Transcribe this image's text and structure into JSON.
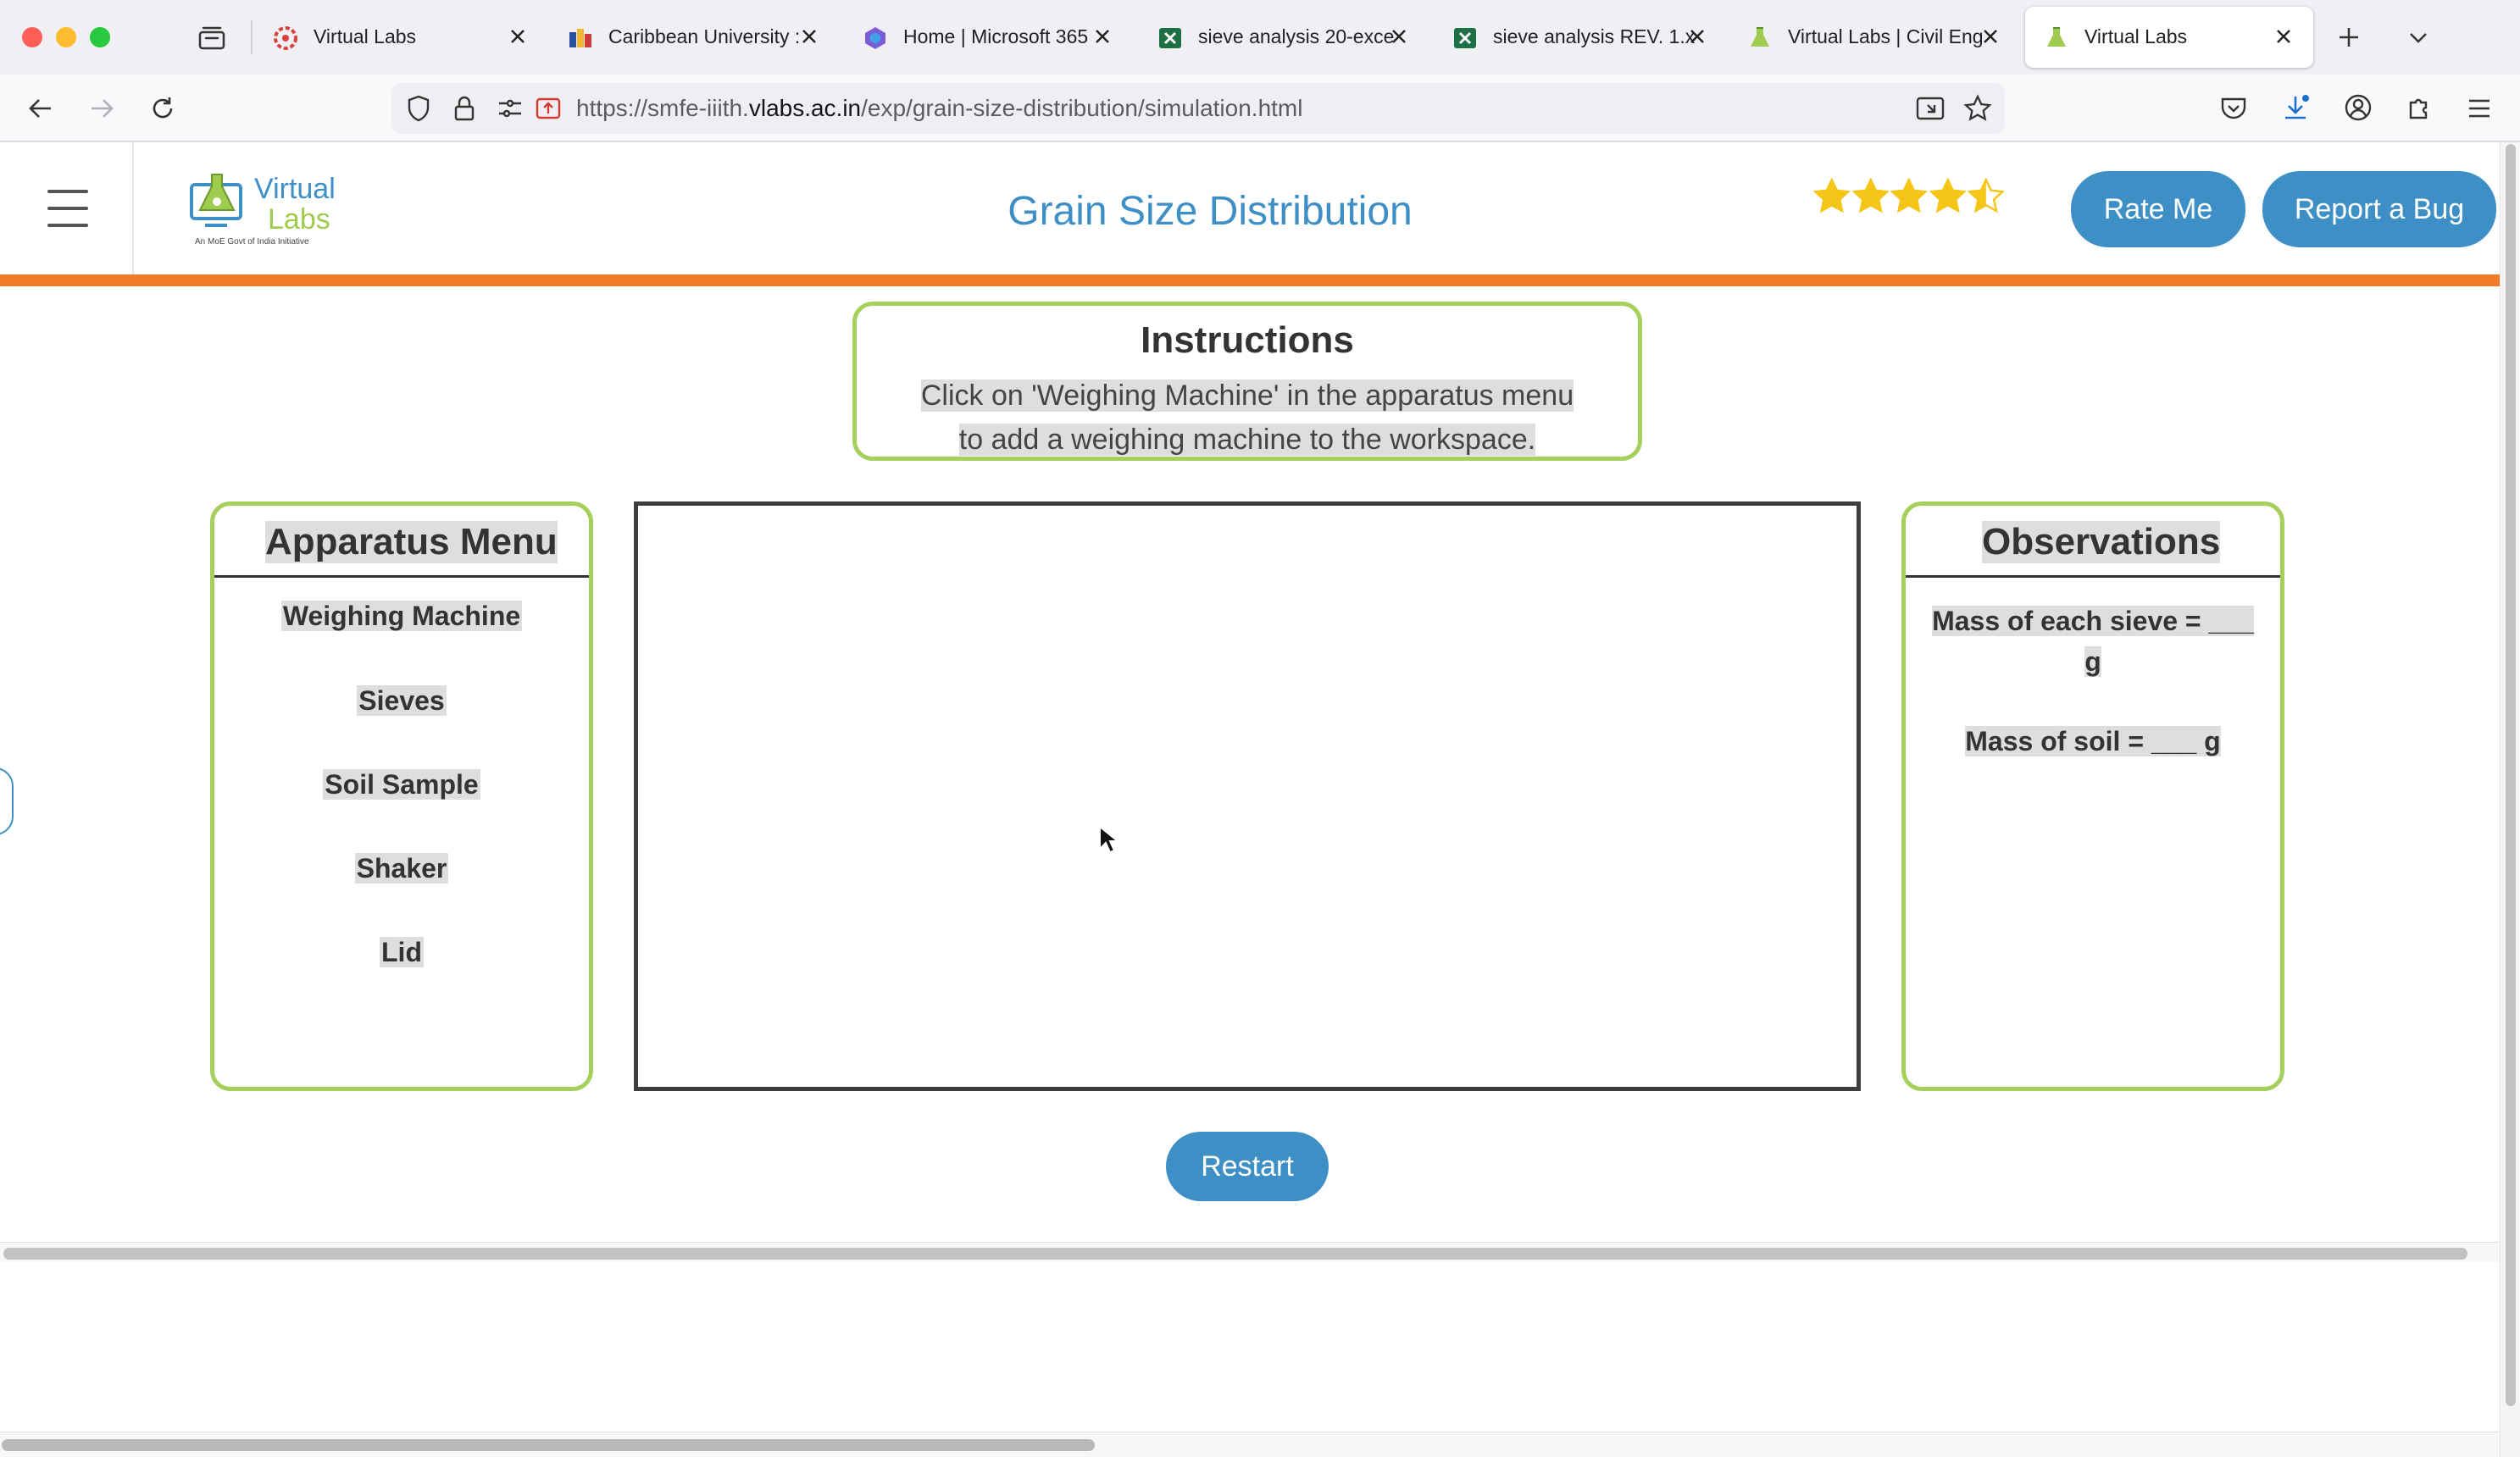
{
  "browser": {
    "tabs": [
      {
        "label": "Virtual Labs",
        "active": false
      },
      {
        "label": "Caribbean University :",
        "active": false
      },
      {
        "label": "Home | Microsoft 365",
        "active": false
      },
      {
        "label": "sieve analysis 20-exce",
        "active": false
      },
      {
        "label": "sieve analysis REV. 1.x",
        "active": false
      },
      {
        "label": "Virtual Labs | Civil Eng",
        "active": false
      },
      {
        "label": "Virtual Labs",
        "active": true
      }
    ],
    "url_prefix": "https://smfe-iiith.",
    "url_domain": "vlabs.ac.in",
    "url_path": "/exp/grain-size-distribution/simulation.html"
  },
  "header": {
    "logo_word1": "Virtual",
    "logo_word2": "Labs",
    "logo_tagline": "An MoE Govt of India Initiative",
    "title": "Grain Size Distribution",
    "rating_stars": 4.5,
    "rating_max": 5,
    "rate_me_label": "Rate Me",
    "report_bug_label": "Report a Bug"
  },
  "instructions": {
    "title": "Instructions",
    "line1": "Click on 'Weighing Machine' in the apparatus menu",
    "line2": "to add a weighing machine to the workspace."
  },
  "apparatus": {
    "title": "Apparatus Menu",
    "items": [
      "Weighing Machine",
      "Sieves",
      "Soil Sample",
      "Shaker",
      "Lid"
    ]
  },
  "observations": {
    "title": "Observations",
    "sieve_line1": "Mass of each sieve = ___",
    "sieve_line2": "g",
    "soil_line": "Mass of soil = ___ g"
  },
  "restart_label": "Restart",
  "colors": {
    "accent_blue": "#3d8fc6",
    "orange_bar": "#f07c2a",
    "green_border": "#a6cf5c",
    "star": "#f5c518"
  }
}
